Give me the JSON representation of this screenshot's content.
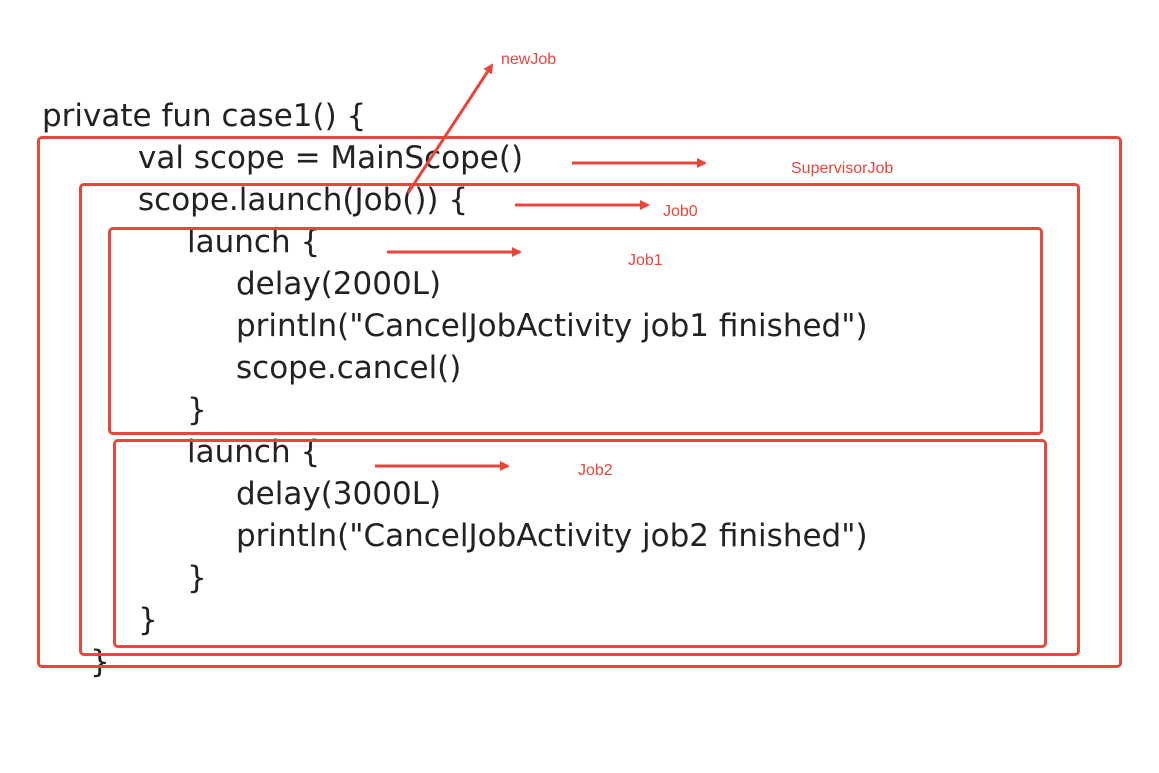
{
  "code_lines": [
    "private fun case1() {",
    "val scope = MainScope()",
    "scope.launch(Job()) {",
    "launch {",
    "delay(2000L)",
    "println(\"CancelJobActivity job1 finished\")",
    "scope.cancel()",
    "}",
    "launch {",
    "delay(3000L)",
    "println(\"CancelJobActivity job2 finished\")",
    "}",
    "}",
    "}"
  ],
  "labels": {
    "new_job": "newJob",
    "supervisor_job": "SupervisorJob",
    "job0": "Job0",
    "job1": "Job1",
    "job2": "Job2"
  },
  "colors": {
    "annotation": "#e8453c",
    "code_text": "#222222",
    "background": "#ffffff"
  }
}
